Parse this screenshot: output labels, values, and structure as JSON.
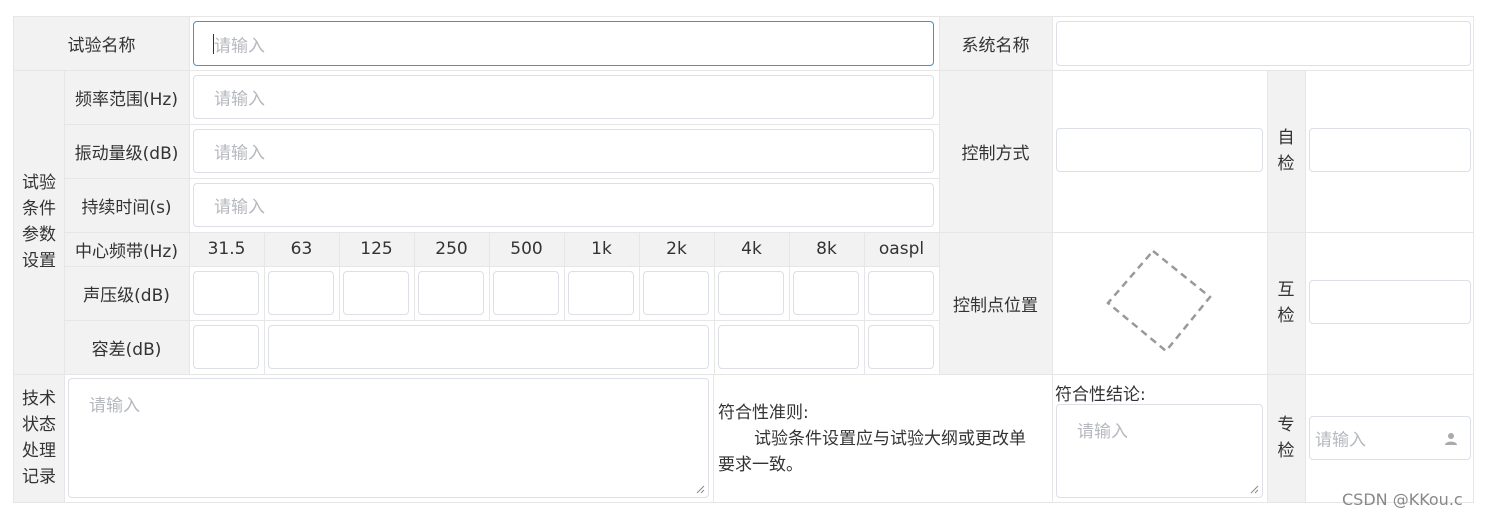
{
  "row1": {
    "test_name_label": "试验名称",
    "test_name_placeholder": "请输入",
    "system_name_label": "系统名称"
  },
  "conditions": {
    "group_label_lines": [
      "试验",
      "条件",
      "参数",
      "设置"
    ],
    "freq_range_label": "频率范围(Hz)",
    "vibration_label": "振动量级(dB)",
    "duration_label": "持续时间(s)",
    "placeholder": "请输入",
    "center_band_label": "中心频带(Hz)",
    "bands": [
      "31.5",
      "63",
      "125",
      "250",
      "500",
      "1k",
      "2k",
      "4k",
      "8k",
      "oaspl"
    ],
    "spl_label": "声压级(dB)",
    "tolerance_label": "容差(dB)"
  },
  "control": {
    "mode_label": "控制方式",
    "point_label": "控制点位置",
    "self_check_lines": [
      "自",
      "检"
    ],
    "mutual_check_lines": [
      "互",
      "检"
    ],
    "special_check_lines": [
      "专",
      "检"
    ]
  },
  "tech": {
    "label_lines": [
      "技术",
      "状态",
      "处理",
      "记录"
    ],
    "placeholder": "请输入",
    "criteria_title": "符合性准则:",
    "criteria_text_line1": "试验条件设置应与试验大纲或更改单",
    "criteria_text_line2": "要求一致。",
    "conclusion_title": "符合性结论:",
    "conclusion_placeholder": "请输入",
    "special_check_placeholder": "请输入"
  },
  "watermark": "CSDN @KKou.c"
}
